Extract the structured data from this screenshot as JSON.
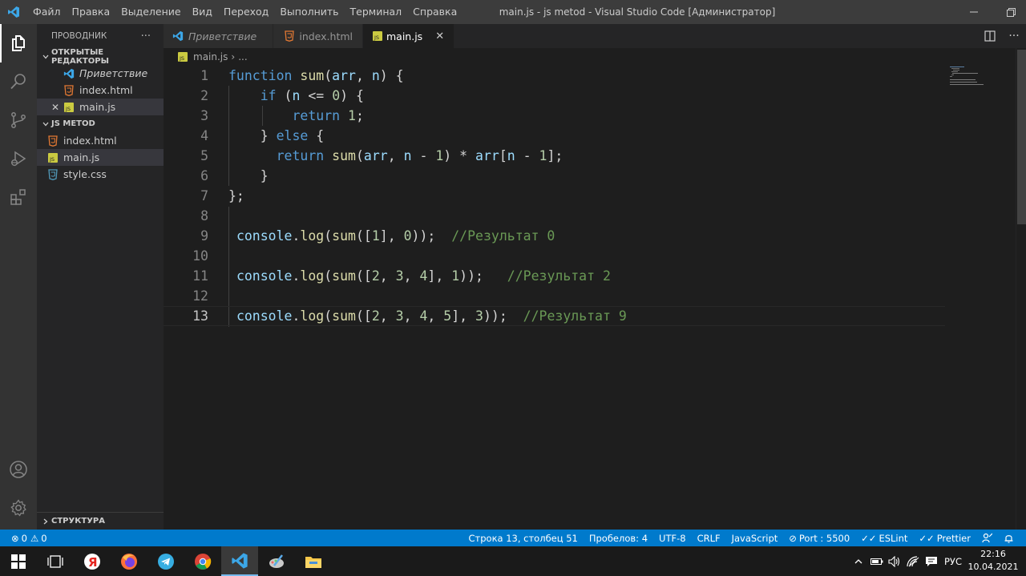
{
  "titlebar": {
    "menu": [
      "Файл",
      "Правка",
      "Выделение",
      "Вид",
      "Переход",
      "Выполнить",
      "Терминал",
      "Справка"
    ],
    "window_title": "main.js - js metod - Visual Studio Code [Администратор]"
  },
  "sidebar": {
    "header": "ПРОВОДНИК",
    "more": "···",
    "open_editors_title": "ОТКРЫТЫЕ РЕДАКТОРЫ",
    "open_editors": [
      {
        "label": "Приветствие"
      },
      {
        "label": "index.html"
      },
      {
        "label": "main.js"
      }
    ],
    "folder_title": "JS METOD",
    "files": [
      {
        "label": "index.html"
      },
      {
        "label": "main.js"
      },
      {
        "label": "style.css"
      }
    ],
    "outline_title": "СТРУКТУРА"
  },
  "tabs": [
    {
      "label": "Приветствие"
    },
    {
      "label": "index.html"
    },
    {
      "label": "main.js"
    }
  ],
  "breadcrumb": {
    "file": "main.js",
    "sep": "›",
    "rest": "..."
  },
  "editor": {
    "line_numbers": [
      "1",
      "2",
      "3",
      "4",
      "5",
      "6",
      "7",
      "8",
      "9",
      "10",
      "11",
      "12",
      "13"
    ],
    "current_line": 13,
    "comments": [
      "//Результат 0",
      "//Результат 2",
      "//Результат 9"
    ]
  },
  "statusbar": {
    "errors": "0",
    "warnings": "0",
    "position": "Строка 13, столбец 51",
    "spaces": "Пробелов: 4",
    "encoding": "UTF-8",
    "eol": "CRLF",
    "language": "JavaScript",
    "port": "Port : 5500",
    "eslint": "ESLint",
    "prettier": "Prettier"
  },
  "taskbar": {
    "lang": "РУС",
    "time": "22:16",
    "date": "10.04.2021"
  },
  "colors": {
    "accent": "#007acc",
    "keyword": "#569cd6",
    "control": "#c586c0",
    "function": "#dcdcaa",
    "variable": "#9cdcfe",
    "number": "#b5cea8",
    "comment": "#6a9955"
  }
}
